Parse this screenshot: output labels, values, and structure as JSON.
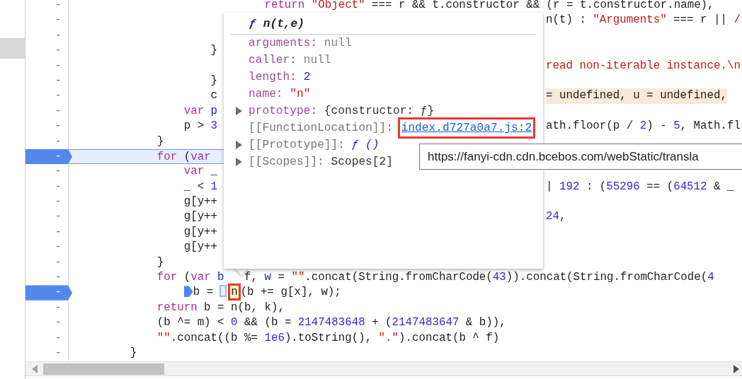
{
  "sidebar": {
    "selected_row": true
  },
  "lines": [
    {
      "marker": "-",
      "breakpoint": false,
      "current": false,
      "left": [
        {
          "kind": "kw",
          "text": "                            return"
        },
        {
          "kind": "str",
          "text": " \"Object\""
        },
        {
          "kind": "plain",
          "text": " === r && t.constructor && (r = t.constructor.name),"
        }
      ]
    },
    {
      "marker": "-",
      "breakpoint": false,
      "current": false,
      "right": {
        "highlighted": false,
        "tokens": [
          {
            "kind": "plain",
            "text": "n(t) : "
          },
          {
            "kind": "str",
            "text": "\"Arguments\""
          },
          {
            "kind": "plain",
            "text": " === r || "
          },
          {
            "kind": "str",
            "text": "/"
          }
        ]
      }
    },
    {
      "marker": "-",
      "breakpoint": false,
      "current": false
    },
    {
      "marker": "-",
      "breakpoint": false,
      "current": false,
      "left": [
        {
          "kind": "plain",
          "text": "                    }"
        }
      ]
    },
    {
      "marker": "-",
      "breakpoint": false,
      "current": false,
      "right": {
        "highlighted": false,
        "tokens": [
          {
            "kind": "str",
            "text": "read non-iterable instance.\\n"
          }
        ]
      }
    },
    {
      "marker": "-",
      "breakpoint": false,
      "current": false,
      "left": [
        {
          "kind": "plain",
          "text": "                    }"
        }
      ]
    },
    {
      "marker": "-",
      "breakpoint": false,
      "current": false,
      "left": [
        {
          "kind": "plain",
          "text": "                    c"
        }
      ],
      "right": {
        "highlighted": true,
        "tokens": [
          {
            "kind": "plain",
            "text": "= undefined, u = undefined,"
          }
        ]
      }
    },
    {
      "marker": "-",
      "breakpoint": false,
      "current": false,
      "left": [
        {
          "kind": "kw",
          "text": "                var"
        },
        {
          "kind": "def",
          "text": " p"
        }
      ]
    },
    {
      "marker": "-",
      "breakpoint": false,
      "current": false,
      "left": [
        {
          "kind": "plain",
          "text": "                p > "
        },
        {
          "kind": "num",
          "text": "3"
        }
      ],
      "right": {
        "highlighted": false,
        "tokens": [
          {
            "kind": "plain",
            "text": "ath.floor(p / "
          },
          {
            "kind": "num",
            "text": "2"
          },
          {
            "kind": "plain",
            "text": ") - "
          },
          {
            "kind": "num",
            "text": "5"
          },
          {
            "kind": "plain",
            "text": ", Math.fl"
          }
        ]
      }
    },
    {
      "marker": "-",
      "breakpoint": false,
      "current": false,
      "left": [
        {
          "kind": "plain",
          "text": "            }"
        }
      ]
    },
    {
      "marker": "-",
      "breakpoint": true,
      "current": true,
      "left": [
        {
          "kind": "kw",
          "text": "            for"
        },
        {
          "kind": "plain",
          "text": " ("
        },
        {
          "kind": "kw",
          "text": "var"
        }
      ]
    },
    {
      "marker": "-",
      "breakpoint": false,
      "current": false,
      "left": [
        {
          "kind": "kw",
          "text": "                var"
        },
        {
          "kind": "plain",
          "text": " _"
        }
      ]
    },
    {
      "marker": "-",
      "breakpoint": false,
      "current": false,
      "left": [
        {
          "kind": "plain",
          "text": "                _ < "
        },
        {
          "kind": "num",
          "text": "1"
        }
      ],
      "right": {
        "highlighted": false,
        "tokens": [
          {
            "kind": "plain",
            "text": "| "
          },
          {
            "kind": "num",
            "text": "192"
          },
          {
            "kind": "plain",
            "text": " : ("
          },
          {
            "kind": "num",
            "text": "55296"
          },
          {
            "kind": "plain",
            "text": " == ("
          },
          {
            "kind": "num",
            "text": "64512"
          },
          {
            "kind": "plain",
            "text": " & _"
          }
        ]
      }
    },
    {
      "marker": "-",
      "breakpoint": false,
      "current": false,
      "left": [
        {
          "kind": "plain",
          "text": "                g[y++"
        }
      ]
    },
    {
      "marker": "-",
      "breakpoint": false,
      "current": false,
      "left": [
        {
          "kind": "plain",
          "text": "                g[y++"
        }
      ],
      "right": {
        "highlighted": false,
        "tokens": [
          {
            "kind": "num",
            "text": "24"
          },
          {
            "kind": "plain",
            "text": ","
          }
        ]
      }
    },
    {
      "marker": "-",
      "breakpoint": false,
      "current": false,
      "left": [
        {
          "kind": "plain",
          "text": "                g[y++"
        }
      ]
    },
    {
      "marker": "-",
      "breakpoint": false,
      "current": false,
      "left": [
        {
          "kind": "plain",
          "text": "                g[y++"
        }
      ]
    },
    {
      "marker": "-",
      "breakpoint": false,
      "current": false,
      "left": [
        {
          "kind": "plain",
          "text": "            }"
        }
      ]
    },
    {
      "marker": "-",
      "breakpoint": false,
      "current": false,
      "left": [
        {
          "kind": "kw",
          "text": "            for"
        },
        {
          "kind": "plain",
          "text": " ("
        },
        {
          "kind": "kw",
          "text": "var"
        },
        {
          "kind": "def",
          "text": " b"
        },
        {
          "kind": "plain",
          "text": "   f, "
        },
        {
          "kind": "def",
          "text": "w"
        },
        {
          "kind": "plain",
          "text": " = "
        },
        {
          "kind": "str",
          "text": "\"\""
        },
        {
          "kind": "plain",
          "text": ".concat(String.fromCharCode("
        },
        {
          "kind": "num",
          "text": "43"
        },
        {
          "kind": "plain",
          "text": ")).concat(String.fromCharCode("
        },
        {
          "kind": "num",
          "text": "4"
        }
      ]
    },
    {
      "marker": "-",
      "breakpoint": true,
      "current": false,
      "left": [
        {
          "kind": "step"
        },
        {
          "kind": "plain",
          "text": "b ="
        },
        {
          "kind": "inline"
        },
        {
          "kind": "match",
          "text": "n",
          "outlined": true
        },
        {
          "kind": "plain",
          "text": "(b += g[x], w);"
        }
      ]
    },
    {
      "marker": "-",
      "breakpoint": false,
      "current": false,
      "left": [
        {
          "kind": "kw",
          "text": "            return"
        },
        {
          "kind": "plain",
          "text": " b = n(b, k),"
        }
      ]
    },
    {
      "marker": "-",
      "breakpoint": false,
      "current": false,
      "left": [
        {
          "kind": "plain",
          "text": "            (b ^= m) < "
        },
        {
          "kind": "num",
          "text": "0"
        },
        {
          "kind": "plain",
          "text": " && (b = "
        },
        {
          "kind": "num",
          "text": "2147483648"
        },
        {
          "kind": "plain",
          "text": " + ("
        },
        {
          "kind": "num",
          "text": "2147483647"
        },
        {
          "kind": "plain",
          "text": " & b)),"
        }
      ]
    },
    {
      "marker": "-",
      "breakpoint": false,
      "current": false,
      "left": [
        {
          "kind": "str",
          "text": "            \"\""
        },
        {
          "kind": "plain",
          "text": ".concat((b %= "
        },
        {
          "kind": "num",
          "text": "1e6"
        },
        {
          "kind": "plain",
          "text": ").toString(), "
        },
        {
          "kind": "str",
          "text": "\".\""
        },
        {
          "kind": "plain",
          "text": ").concat(b ^ f)"
        }
      ]
    },
    {
      "marker": "-",
      "breakpoint": false,
      "current": false,
      "left": [
        {
          "kind": "plain",
          "text": "        }"
        }
      ]
    }
  ],
  "popover": {
    "symbol": "ƒ",
    "signature": "n(t,e)",
    "properties": [
      {
        "name": "arguments:",
        "internal": false,
        "expandable": false,
        "value": {
          "kind": "null",
          "text": "null"
        }
      },
      {
        "name": "caller:",
        "internal": false,
        "expandable": false,
        "value": {
          "kind": "null",
          "text": "null"
        }
      },
      {
        "name": "length:",
        "internal": false,
        "expandable": false,
        "value": {
          "kind": "number",
          "text": "2"
        }
      },
      {
        "name": "name:",
        "internal": false,
        "expandable": false,
        "value": {
          "kind": "string",
          "text": "\"n\""
        }
      },
      {
        "name": "prototype:",
        "internal": false,
        "expandable": true,
        "value": {
          "kind": "object",
          "text": "{constructor: ƒ}"
        }
      },
      {
        "name": "[[FunctionLocation]]:",
        "internal": true,
        "expandable": false,
        "value": {
          "kind": "link",
          "text": "index.d727a0a7.js:2",
          "outlined": true
        }
      },
      {
        "name": "[[Prototype]]:",
        "internal": true,
        "expandable": true,
        "value": {
          "kind": "function",
          "text": "ƒ ()"
        }
      },
      {
        "name": "[[Scopes]]:",
        "internal": true,
        "expandable": true,
        "value": {
          "kind": "object",
          "text": "Scopes[2]"
        }
      }
    ]
  },
  "tooltip": "https://fanyi-cdn.cdn.bcebos.com/webStatic/transla"
}
